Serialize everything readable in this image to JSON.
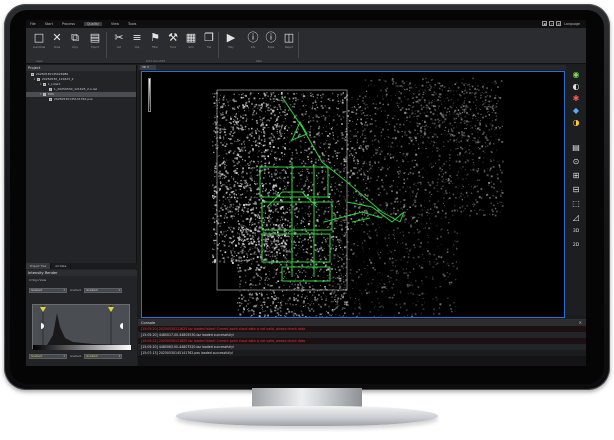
{
  "app": {
    "menu": [
      "File",
      "Start",
      "Process",
      "Quality",
      "View",
      "Tools"
    ],
    "active_menu_index": 3,
    "right_icons": [
      "▣",
      "?",
      "⚙"
    ],
    "language_label": "Language"
  },
  "ribbon": {
    "buttons": [
      {
        "icon": "□",
        "label": "Load Data",
        "name": "load-data-icon"
      },
      {
        "icon": "✕",
        "label": "Close",
        "name": "close-data-icon"
      },
      {
        "icon": "⧉",
        "label": "Copy",
        "name": "copy-icon"
      },
      {
        "icon": "▤",
        "label": "Export",
        "name": "export-icon"
      },
      {
        "icon": "✂",
        "label": "Cut",
        "name": "cut-icon"
      },
      {
        "icon": "≡",
        "label": "Clip",
        "name": "clip-icon"
      },
      {
        "icon": "⚑",
        "label": "Filter",
        "name": "filter-icon"
      },
      {
        "icon": "⚒",
        "label": "Tools",
        "name": "tools-icon"
      },
      {
        "icon": "▦",
        "label": "Grid",
        "name": "grid-icon"
      },
      {
        "icon": "❐",
        "label": "Tile",
        "name": "tile-icon"
      },
      {
        "icon": "▶",
        "label": "Play",
        "name": "play-icon"
      },
      {
        "icon": "ⓘ",
        "label": "Info",
        "name": "info-icon"
      },
      {
        "icon": "ⓘ",
        "label": "Props",
        "name": "properties-icon"
      },
      {
        "icon": "◫",
        "label": "Report",
        "name": "report-icon"
      }
    ],
    "groups": [
      "Layer",
      "Point Cloud Edit",
      "Data"
    ]
  },
  "project": {
    "title": "Project",
    "tree": [
      {
        "indent": 0,
        "twisty": "",
        "checked": true,
        "label": "20250530145026980",
        "selected": false
      },
      {
        "indent": 1,
        "twisty": "▾",
        "checked": true,
        "label": "20250530_121625_2",
        "selected": false
      },
      {
        "indent": 2,
        "twisty": "▾",
        "checked": true,
        "label": "1_Lidar1",
        "selected": false
      },
      {
        "indent": 3,
        "twisty": "",
        "checked": true,
        "label": "1_20250530_121625_2-1.laz",
        "selected": false
      },
      {
        "indent": 2,
        "twisty": "▾",
        "checked": true,
        "label": "POS",
        "selected": true
      },
      {
        "indent": 3,
        "twisty": "",
        "checked": true,
        "label": "20250530145141762.pos",
        "selected": false
      }
    ],
    "bottom_tabs": [
      "Project Tree",
      "All Data"
    ]
  },
  "intensity": {
    "title": "Intensity Render",
    "checkbox_label": "Sign View",
    "row1_left": "Gradient",
    "row1_mid": "Gradient",
    "row1_right": "Gradient",
    "row2_left": "Gradient",
    "row2_mid": "Gradient",
    "row2_right": "Gradient"
  },
  "viewport": {
    "tab_label": "3D"
  },
  "console": {
    "title": "Console",
    "lines": [
      {
        "type": "err",
        "text": "[15:05:20] 20250530121625 laz loaded failed! Current point cloud data is not valid, please check data"
      },
      {
        "type": "ok",
        "text": "[15:05:20] 4480017.00-44805530.laz loaded successfully!"
      },
      {
        "type": "err",
        "text": "[15:05:22] 20250530121625 laz loaded failed! Current point cloud data is not valid, please check data"
      },
      {
        "type": "ok",
        "text": "[15:05:20] 4480063.00-44807520.laz loaded successfully!"
      },
      {
        "type": "ok",
        "text": "[15:07:13] 20250530145141762.pos loaded successfully!"
      }
    ]
  },
  "colors": {
    "accent": "#2b6fd6",
    "trajectory": "#2fd13f",
    "error": "#e03b3b"
  }
}
